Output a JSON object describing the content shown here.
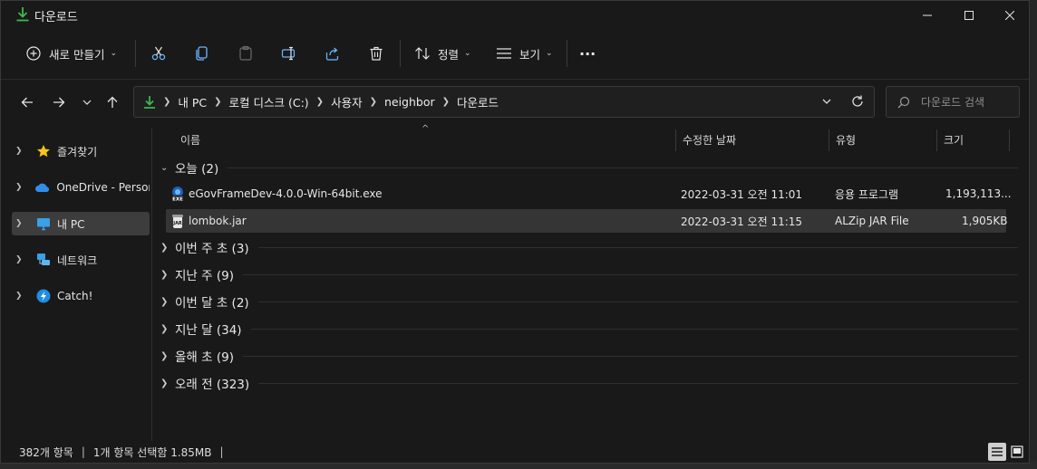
{
  "window": {
    "title": "다운로드",
    "controls": {
      "minimize": "—",
      "maximize": "☐",
      "close": "✕"
    }
  },
  "commandbar": {
    "new_label": "새로 만들기",
    "sort_label": "정렬",
    "view_label": "보기",
    "more_label": "···"
  },
  "address": {
    "crumbs": [
      "내 PC",
      "로컬 디스크 (C:)",
      "사용자",
      "neighbor",
      "다운로드"
    ]
  },
  "search": {
    "placeholder": "다운로드 검색"
  },
  "nav": {
    "items": [
      {
        "label": "즐겨찾기",
        "icon": "star-icon"
      },
      {
        "label": "OneDrive - Persona",
        "icon": "cloud-icon"
      },
      {
        "label": "내 PC",
        "icon": "monitor-icon",
        "selected": true
      },
      {
        "label": "네트워크",
        "icon": "network-icon"
      },
      {
        "label": "Catch!",
        "icon": "catch-icon"
      }
    ]
  },
  "columns": {
    "name": "이름",
    "modified": "수정한 날짜",
    "type": "유형",
    "size": "크기"
  },
  "groups": [
    {
      "label": "오늘 (2)",
      "expanded": true
    },
    {
      "label": "이번 주 초 (3)"
    },
    {
      "label": "지난 주 (9)"
    },
    {
      "label": "이번 달 초 (2)"
    },
    {
      "label": "지난 달 (34)"
    },
    {
      "label": "올해 초 (9)"
    },
    {
      "label": "오래 전 (323)"
    }
  ],
  "files": [
    {
      "name": "eGovFrameDev-4.0.0-Win-64bit.exe",
      "modified": "2022-03-31 오전 11:01",
      "type": "응용 프로그램",
      "size": "1,193,113...",
      "icon": "exe-icon"
    },
    {
      "name": "lombok.jar",
      "modified": "2022-03-31 오전 11:15",
      "type": "ALZip JAR File",
      "size": "1,905KB",
      "icon": "jar-icon",
      "selected": true
    }
  ],
  "status": {
    "count": "382개 항목",
    "selection": "1개 항목 선택함 1.85MB",
    "bar": "|"
  },
  "colors": {
    "accent": "#4cc2ff",
    "download_green": "#3fb950",
    "background": "#191919"
  }
}
